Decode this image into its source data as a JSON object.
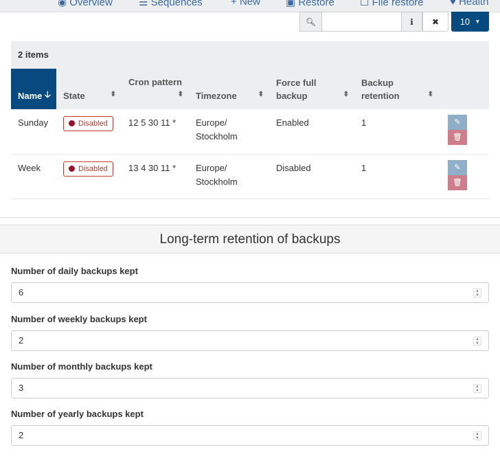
{
  "nav": [
    "Overview",
    "Sequences",
    "New",
    "Restore",
    "File restore",
    "Health"
  ],
  "toolbar": {
    "search_placeholder": "",
    "page_size": "10"
  },
  "table": {
    "count": "2 items",
    "headers": [
      "Name",
      "State",
      "Cron pattern",
      "Timezone",
      "Force full backup",
      "Backup retention"
    ],
    "rows": [
      {
        "name": "Sunday",
        "state": "Disabled",
        "cron": "12 5 30 11 *",
        "tz": "Europe/ Stockholm",
        "force": "Enabled",
        "retention": "1"
      },
      {
        "name": "Week",
        "state": "Disabled",
        "cron": "13 4 30 11 *",
        "tz": "Europe/ Stockholm",
        "force": "Disabled",
        "retention": "1"
      }
    ]
  },
  "retention": {
    "title": "Long-term retention of backups",
    "fields": [
      {
        "label": "Number of daily backups kept",
        "value": "6"
      },
      {
        "label": "Number of weekly backups kept",
        "value": "2"
      },
      {
        "label": "Number of monthly backups kept",
        "value": "3"
      },
      {
        "label": "Number of yearly backups kept",
        "value": "2"
      }
    ]
  },
  "colors": {
    "primary": "#064a80",
    "danger": "#c0392b"
  }
}
